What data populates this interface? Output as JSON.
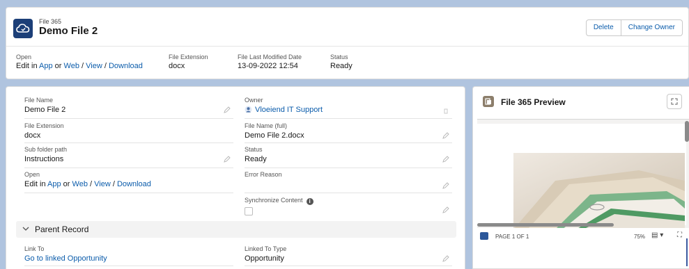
{
  "header": {
    "object_type": "File 365",
    "title": "Demo File 2",
    "buttons": {
      "delete": "Delete",
      "change_owner": "Change Owner"
    },
    "highlights": {
      "open": {
        "label": "Open",
        "edit_in": "Edit in",
        "app": "App",
        "or": "or",
        "web": "Web",
        "sep1": "/",
        "view": "View",
        "sep2": "/",
        "download": "Download"
      },
      "file_extension": {
        "label": "File Extension",
        "value": "docx"
      },
      "last_modified": {
        "label": "File Last Modified Date",
        "value": "13-09-2022 12:54"
      },
      "status": {
        "label": "Status",
        "value": "Ready"
      }
    }
  },
  "details": {
    "left": {
      "file_name": {
        "label": "File Name",
        "value": "Demo File 2"
      },
      "file_extension": {
        "label": "File Extension",
        "value": "docx"
      },
      "sub_folder": {
        "label": "Sub folder path",
        "value": "Instructions"
      },
      "open": {
        "label": "Open",
        "edit_in": "Edit in",
        "app": "App",
        "or": "or",
        "web": "Web",
        "sep1": "/",
        "view": "View",
        "sep2": "/",
        "download": "Download"
      }
    },
    "right": {
      "owner": {
        "label": "Owner",
        "value": "Vloeiend IT Support"
      },
      "file_name_full": {
        "label": "File Name (full)",
        "value": "Demo File 2.docx"
      },
      "status": {
        "label": "Status",
        "value": "Ready"
      },
      "error_reason": {
        "label": "Error Reason",
        "value": ""
      },
      "sync_content": {
        "label": "Synchronize Content",
        "checked": false
      }
    },
    "parent_section": {
      "title": "Parent Record",
      "link_to": {
        "label": "Link To",
        "value": "Go to linked Opportunity"
      },
      "linked_type": {
        "label": "Linked To Type",
        "value": "Opportunity"
      }
    }
  },
  "preview": {
    "title": "File 365 Preview",
    "page_text": "PAGE 1 OF 1",
    "zoom": "75%"
  },
  "colors": {
    "link": "#0b5cab",
    "object_icon": "#1c3f78",
    "background": "#b0c4df"
  }
}
